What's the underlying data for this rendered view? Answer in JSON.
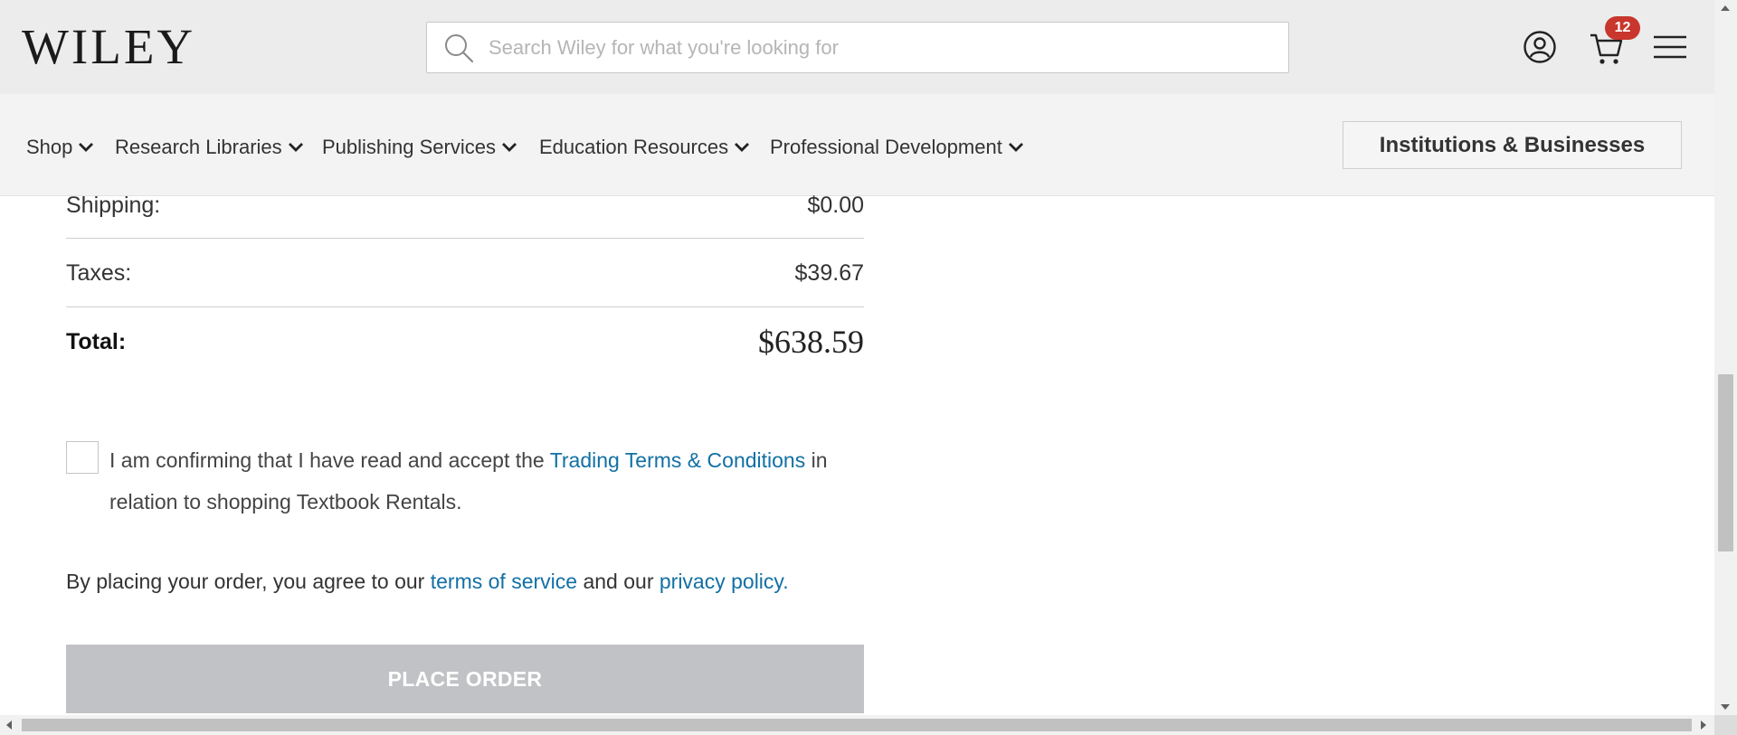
{
  "header": {
    "logo_text": "WILEY",
    "search_placeholder": "Search Wiley for what you're looking for",
    "cart_count": "12",
    "icons": [
      "search-icon",
      "account-icon",
      "cart-icon",
      "hamburger-menu-icon"
    ]
  },
  "nav": {
    "items": [
      {
        "label": "Shop"
      },
      {
        "label": "Research Libraries"
      },
      {
        "label": "Publishing Services"
      },
      {
        "label": "Education Resources"
      },
      {
        "label": "Professional Development"
      }
    ],
    "institutions_button": "Institutions & Businesses"
  },
  "summary": {
    "shipping_label": "Shipping:",
    "shipping_value": "$0.00",
    "taxes_label": "Taxes:",
    "taxes_value": "$39.67",
    "total_label": "Total:",
    "total_value": "$638.59"
  },
  "terms": {
    "text_before": "I am confirming that I have read and accept the ",
    "link": "Trading Terms & Conditions",
    "text_after": " in relation to shopping Textbook Rentals.",
    "checked": false
  },
  "agreement": {
    "prefix": "By placing your order, you agree to our ",
    "tos_link": "terms of service",
    "middle": " and our ",
    "privacy_link": "privacy policy."
  },
  "place_order_label": "PLACE ORDER",
  "colors": {
    "link": "#1270a4",
    "badge": "#c8362d",
    "button_disabled": "#c1c2c5",
    "header_bg": "#ececec"
  }
}
